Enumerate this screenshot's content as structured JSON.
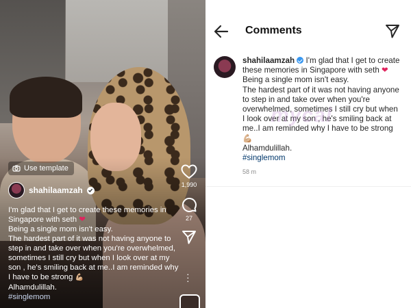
{
  "reel": {
    "use_template_label": "Use template",
    "username": "shahilaamzah",
    "caption_lines": [
      "I'm glad that I get to create these memories in Singapore with seth",
      "Being a single mom isn't easy.",
      "The hardest part of it was not having anyone to step in and take over when you're overwhelmed, sometimes I still cry but when I look over at my son , he's smiling back at me..I am reminded why I have to be strong",
      "Alhamdulillah."
    ],
    "heart_emoji": "❤",
    "muscle_emoji": "💪🏼",
    "hashtag": "#singlemom",
    "like_count": "1,990",
    "comment_count": "27"
  },
  "comments": {
    "title": "Comments",
    "post": {
      "username": "shahilaamzah",
      "line1": "I'm glad that I get to create these memories in Singapore with seth",
      "heart_emoji": "❤",
      "line2": "Being a single mom isn't easy.",
      "line3": "The hardest part of it was not having anyone to step in and take over when you're overwhelmed, sometimes I still cry but when I look over at my son , he's smiling back at me..I am reminded why I have to be strong",
      "muscle_emoji": "💪🏼",
      "line4": "Alhamdulillah.",
      "hashtag": "#singlemom",
      "time": "58 m"
    }
  },
  "watermark": "mycal",
  "colors": {
    "verified_blue": "#3897f0",
    "hashtag_blue": "#00376b",
    "heart_red": "#e0245e"
  }
}
